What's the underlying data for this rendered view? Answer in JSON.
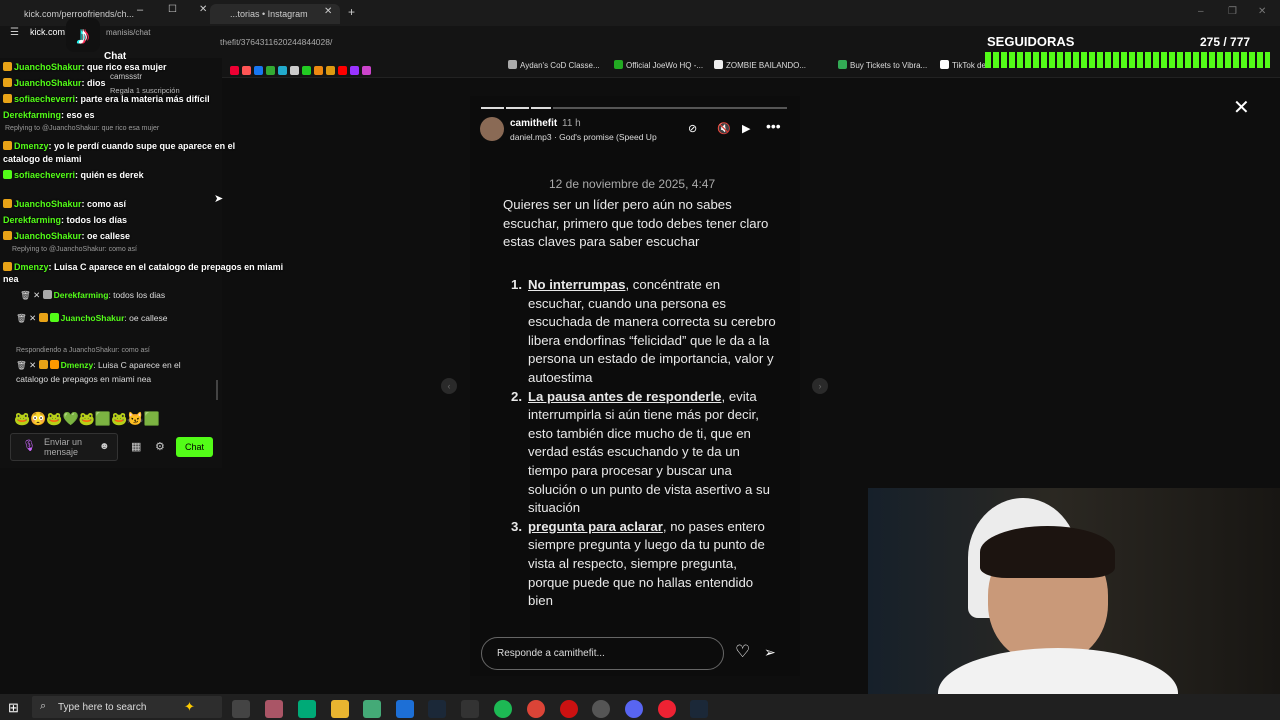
{
  "browser": {
    "tab_left": "kick.com/perroofriends/ch...",
    "tab_right": "...torias • Instagram",
    "addr_left": "kick.com",
    "addr_path": "manisis/chat",
    "addr_main": "thefit/3764311620244844028/",
    "bookmarks": [
      "Aydan's CoD Classe...",
      "Official JoeWo HQ -...",
      "ZOMBIE BAILANDO...",
      "Buy Tickets to Vibra...",
      "TikTok de"
    ]
  },
  "overlay": {
    "followers_label": "SEGUIDORAS",
    "followers_count": "275 / 777"
  },
  "chat": {
    "header": "Chat",
    "sub_user": "camssstr",
    "sub_text": "Regala 1 suscripción",
    "lines": [
      {
        "user": "JuanchoShakur",
        "text": ": que rico esa mujer"
      },
      {
        "user": "JuanchoShakur",
        "text": ": dios"
      },
      {
        "user": "sofiaecheverri",
        "text": ": parte era la materia más difícil"
      },
      {
        "user": "Derekfarming",
        "text": ": eso es"
      },
      {
        "user": "Dmenzy",
        "text": ": yo le perdí cuando supe que aparece en el catalogo de miami"
      },
      {
        "user": "sofiaecheverri",
        "text": ": quién es derek"
      },
      {
        "user": "JuanchoShakur",
        "text": ": como así"
      },
      {
        "user": "Derekfarming",
        "text": ": todos los días"
      },
      {
        "user": "JuanchoShakur",
        "text": ": oe callese"
      },
      {
        "user": "Dmenzy",
        "text": ": Luisa C aparece en el catalogo de prepagos en miami nea"
      }
    ],
    "reply_1": "Replying to @JuanchoShakur: que rico esa mujer",
    "reply_2": "Replying to @JuanchoShakur: como así",
    "reply_3": "Respondiendo a JuanchoShakur: como así",
    "clean": [
      {
        "user": "Derekfarming",
        "text": ": todos los dias"
      },
      {
        "user": "JuanchoShakur",
        "text": ": oe callese"
      },
      {
        "user": "Dmenzy",
        "text": ": Luisa C aparece en el catalogo de prepagos en miami nea"
      }
    ],
    "input_placeholder": "Enviar un mensaje",
    "send_label": "Chat"
  },
  "story": {
    "user": "camithefit",
    "age": "11 h",
    "song": "daniel.mp3 · God's promise (Speed Up",
    "date": "12 de noviembre de 2025, 4:47",
    "intro": "Quieres ser un líder pero aún no sabes escuchar, primero que todo debes tener claro estas claves para saber escuchar",
    "items": [
      {
        "n": "1.",
        "title": "No interrumpas",
        "body": ", concéntrate en escuchar, cuando una persona es escuchada de manera correcta su cerebro libera endorfinas “felicidad” que le da a la persona un estado de importancia, valor y autoestima"
      },
      {
        "n": "2.",
        "title": "La pausa antes de responderle",
        "body": ", evita interrumpirla si aún tiene más por decir, esto también dice mucho de ti, que en verdad estás escuchando y te da un tiempo para procesar y buscar una solución o un punto de vista asertivo a su situación"
      },
      {
        "n": "3.",
        "title": "pregunta para aclarar",
        "body": ", no pases entero siempre pregunta y luego da tu punto de vista al respecto, siempre pregunta, porque puede que no hallas entendido bien"
      }
    ],
    "reply_placeholder": "Responde a camithefit..."
  },
  "taskbar": {
    "search_placeholder": "Type here to search"
  },
  "colors": {
    "kick_green": "#53fc18",
    "bg": "#0e0e0e"
  }
}
